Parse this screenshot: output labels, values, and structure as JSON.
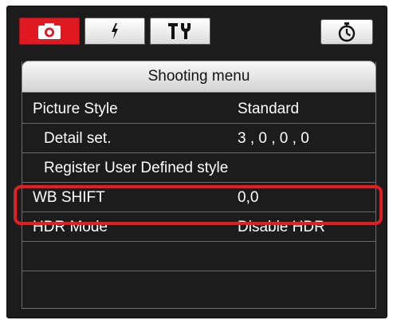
{
  "tabs": [
    {
      "name": "camera",
      "icon": "camera-icon",
      "active": true
    },
    {
      "name": "flash",
      "icon": "flash-icon",
      "active": false
    },
    {
      "name": "tools",
      "icon": "tools-icon",
      "active": false
    },
    {
      "name": "timer",
      "icon": "timer-icon",
      "active": false
    }
  ],
  "menu": {
    "title": "Shooting menu",
    "rows": [
      {
        "label": "Picture Style",
        "value": "Standard"
      },
      {
        "label": "Detail set.",
        "value": "3 , 0 , 0 , 0"
      },
      {
        "label": "Register User Defined style",
        "value": ""
      },
      {
        "label": "WB SHIFT",
        "value": "0,0"
      },
      {
        "label": "HDR Mode",
        "value": "Disable HDR"
      }
    ]
  },
  "colors": {
    "active_tab": "#e01822",
    "highlight": "#e21d24",
    "background": "#1c1c1c"
  }
}
